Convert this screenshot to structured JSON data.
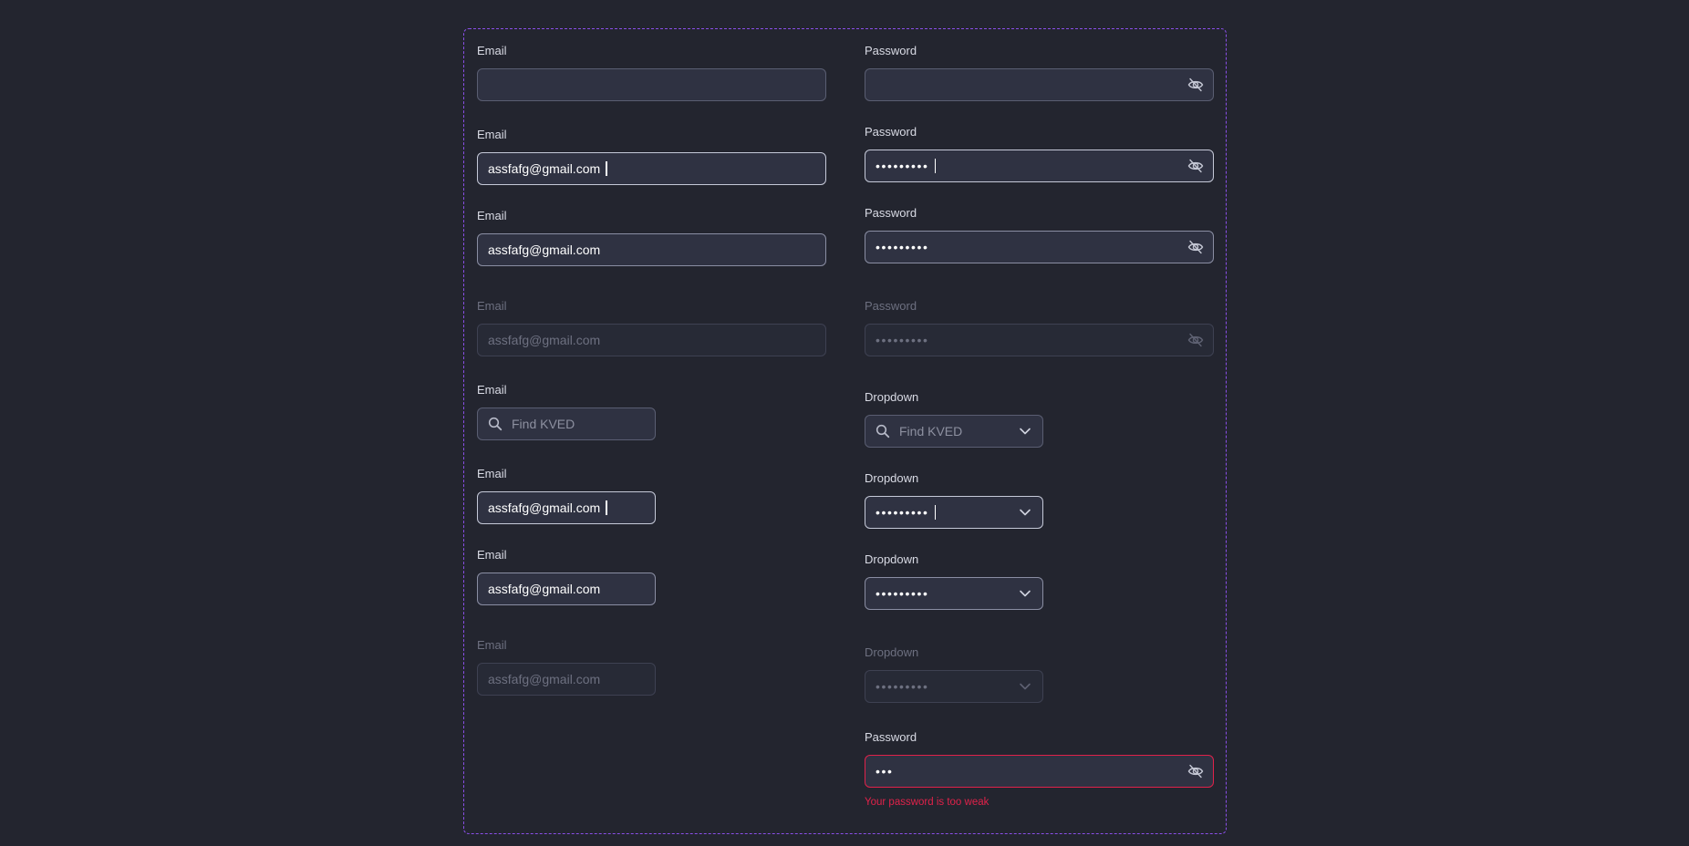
{
  "left_column": [
    {
      "label": "Email",
      "value": "",
      "state": "default"
    },
    {
      "label": "Email",
      "value": "assfafg@gmail.com",
      "state": "focus"
    },
    {
      "label": "Email",
      "value": "assfafg@gmail.com",
      "state": "filled"
    },
    {
      "label": "Email",
      "value": "assfafg@gmail.com",
      "state": "disabled"
    },
    {
      "label": "Email",
      "placeholder": "Find KVED",
      "state": "search"
    },
    {
      "label": "Email",
      "value": "assfafg@gmail.com",
      "state": "focus"
    },
    {
      "label": "Email",
      "value": "assfafg@gmail.com",
      "state": "filled"
    },
    {
      "label": "Email",
      "value": "assfafg@gmail.com",
      "state": "disabled"
    }
  ],
  "right_column": [
    {
      "label": "Password",
      "value": "",
      "state": "default",
      "icon": "eye-off-icon"
    },
    {
      "label": "Password",
      "value": "•••••••••",
      "state": "focus",
      "icon": "eye-off-icon"
    },
    {
      "label": "Password",
      "value": "•••••••••",
      "state": "filled",
      "icon": "eye-off-icon"
    },
    {
      "label": "Password",
      "value": "•••••••••",
      "state": "disabled",
      "icon": "eye-off-icon"
    },
    {
      "label": "Dropdown",
      "placeholder": "Find KVED",
      "state": "search",
      "icon": "chevron-down-icon"
    },
    {
      "label": "Dropdown",
      "value": "•••••••••",
      "state": "focus",
      "icon": "chevron-down-icon"
    },
    {
      "label": "Dropdown",
      "value": "•••••••••",
      "state": "filled",
      "icon": "chevron-down-icon"
    },
    {
      "label": "Dropdown",
      "value": "•••••••••",
      "state": "disabled",
      "icon": "chevron-down-icon"
    },
    {
      "label": "Password",
      "value": "•••",
      "state": "error",
      "icon": "eye-off-icon",
      "error": "Your password is too weak"
    }
  ],
  "colors": {
    "background": "#23252f",
    "frame": "#8a4fe8",
    "error": "#e0224a"
  }
}
